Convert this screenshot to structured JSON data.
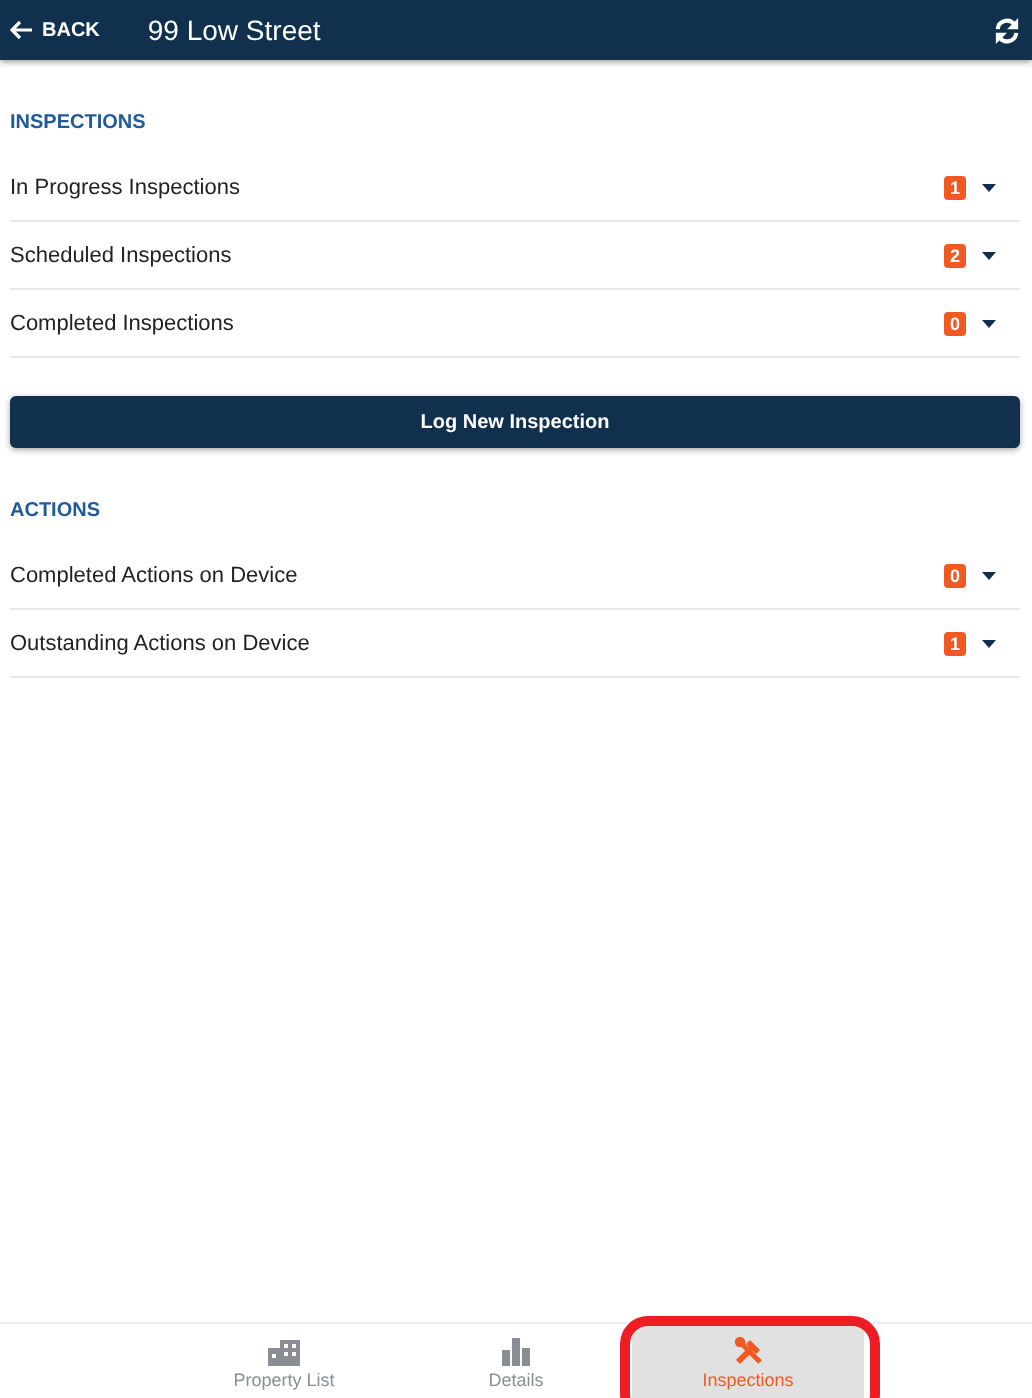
{
  "header": {
    "back": "BACK",
    "title": "99 Low Street"
  },
  "sections": [
    {
      "heading": "INSPECTIONS",
      "rows": [
        {
          "label": "In Progress Inspections",
          "count": "1"
        },
        {
          "label": "Scheduled Inspections",
          "count": "2"
        },
        {
          "label": "Completed Inspections",
          "count": "0"
        }
      ],
      "button": "Log New Inspection"
    },
    {
      "heading": "ACTIONS",
      "rows": [
        {
          "label": "Completed Actions on Device",
          "count": "0"
        },
        {
          "label": "Outstanding Actions on Device",
          "count": "1"
        }
      ]
    }
  ],
  "nav": [
    {
      "label": "Property List",
      "kind": "building",
      "selected": false
    },
    {
      "label": "Details",
      "kind": "chart",
      "selected": false
    },
    {
      "label": "Inspections",
      "kind": "tools",
      "selected": true,
      "highlighted": true
    }
  ]
}
